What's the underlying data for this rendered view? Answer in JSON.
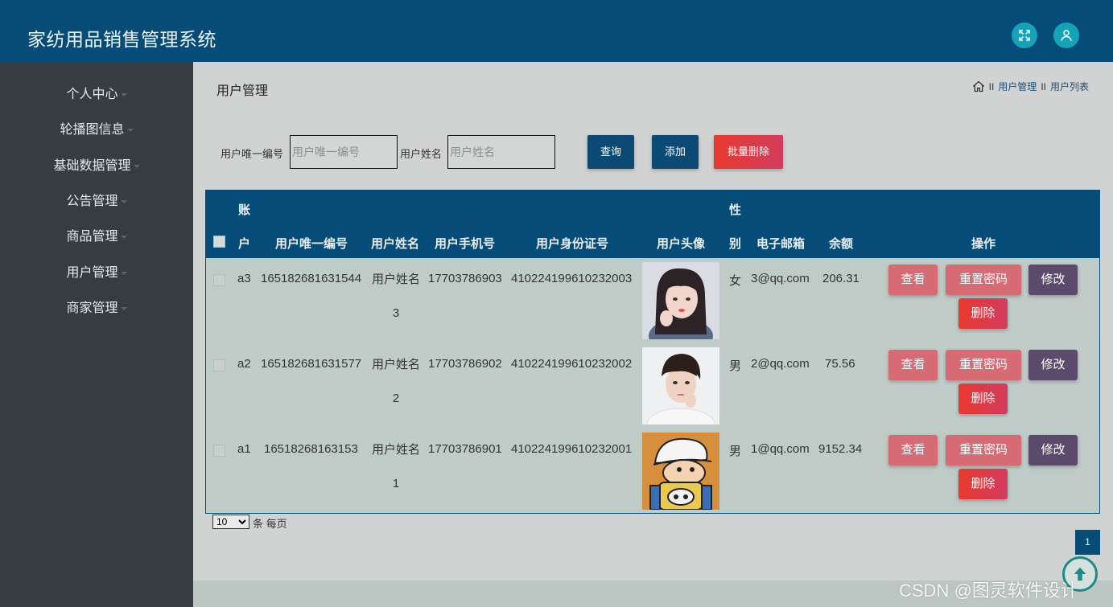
{
  "app": {
    "title": "家纺用品销售管理系统"
  },
  "header": {
    "icons": [
      "fullscreen-icon",
      "user-icon"
    ]
  },
  "sidebar": {
    "items": [
      {
        "label": "个人中心"
      },
      {
        "label": "轮播图信息"
      },
      {
        "label": "基础数据管理"
      },
      {
        "label": "公告管理"
      },
      {
        "label": "商品管理"
      },
      {
        "label": "用户管理"
      },
      {
        "label": "商家管理"
      }
    ]
  },
  "page": {
    "title": "用户管理",
    "breadcrumb": {
      "sep": "II",
      "items": [
        "用户管理",
        "用户列表"
      ]
    }
  },
  "filters": {
    "id_label": "用户唯一编号",
    "id_placeholder": "用户唯一编号",
    "name_label": "用户姓名",
    "name_placeholder": "用户姓名",
    "search_btn": "查询",
    "add_btn": "添加",
    "batch_delete_btn": "批量删除"
  },
  "table": {
    "headers": {
      "account_1": "账",
      "account_2": "户",
      "uid": "用户唯一编号",
      "name": "用户姓名",
      "phone": "用户手机号",
      "idcard": "用户身份证号",
      "avatar": "用户头像",
      "gender_1": "性",
      "gender_2": "别",
      "email": "电子邮箱",
      "balance": "余额",
      "actions": "操作"
    },
    "rows": [
      {
        "account": "a3",
        "uid": "165182681631544",
        "name": "用户姓名3",
        "phone": "17703786903",
        "idcard": "410224199610232003",
        "gender": "女",
        "email": "3@qq.com",
        "balance": "206.31",
        "avatar": "girl-photo"
      },
      {
        "account": "a2",
        "uid": "165182681631577",
        "name": "用户姓名2",
        "phone": "17703786902",
        "idcard": "410224199610232002",
        "gender": "男",
        "email": "2@qq.com",
        "balance": "75.56",
        "avatar": "boy-photo"
      },
      {
        "account": "a1",
        "uid": "16518268163153",
        "name": "用户姓名1",
        "phone": "17703786901",
        "idcard": "410224199610232001",
        "gender": "男",
        "email": "1@qq.com",
        "balance": "9152.34",
        "avatar": "cartoon"
      }
    ],
    "row_actions": {
      "view": "查看",
      "reset": "重置密码",
      "edit": "修改",
      "delete": "删除"
    }
  },
  "pagination": {
    "page_size": "10",
    "page_size_options": [
      "10"
    ],
    "per_page_text": "条 每页",
    "current_page": "1"
  },
  "watermark": "CSDN @图灵软件设计",
  "colors": {
    "header_bg": "#064c79",
    "sidebar_bg": "#353d43",
    "content_bg": "#d1d3d2",
    "accent_teal": "#14a3b8",
    "btn_blue": "#0b4a74",
    "btn_red": "#e8392e",
    "btn_pink": "#d66b74",
    "btn_purple": "#5b4a6b"
  }
}
